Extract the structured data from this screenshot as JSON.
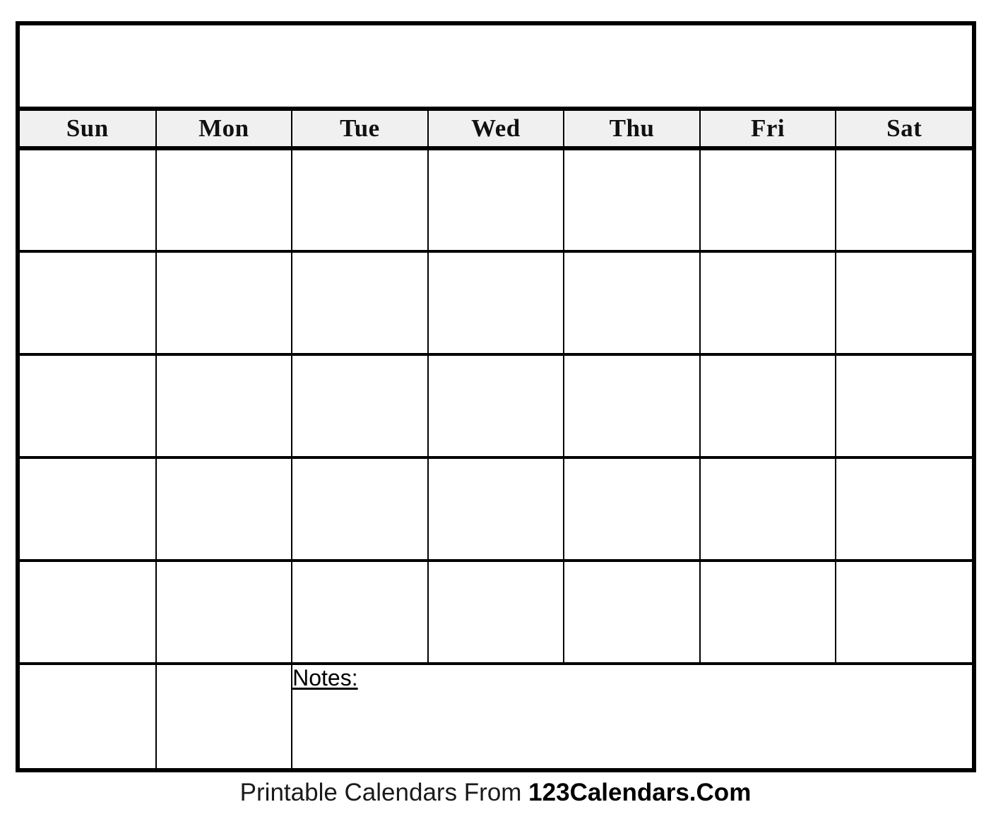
{
  "document": {
    "type": "blank-printable-monthly-calendar",
    "title_row_text": "",
    "background_color": "#ffffff",
    "border_color": "#000000",
    "header_background_color": "#f0f0f0"
  },
  "calendar": {
    "weekday_headers": [
      {
        "label": "Sun"
      },
      {
        "label": "Mon"
      },
      {
        "label": "Tue"
      },
      {
        "label": "Wed"
      },
      {
        "label": "Thu"
      },
      {
        "label": "Fri"
      },
      {
        "label": "Sat"
      }
    ],
    "week_rows": [
      {
        "cells": [
          "",
          "",
          "",
          "",
          "",
          "",
          ""
        ]
      },
      {
        "cells": [
          "",
          "",
          "",
          "",
          "",
          "",
          ""
        ]
      },
      {
        "cells": [
          "",
          "",
          "",
          "",
          "",
          "",
          ""
        ]
      },
      {
        "cells": [
          "",
          "",
          "",
          "",
          "",
          "",
          ""
        ]
      },
      {
        "cells": [
          "",
          "",
          "",
          "",
          "",
          "",
          ""
        ]
      }
    ],
    "last_row": {
      "day_cells": [
        "",
        ""
      ],
      "notes_label": "Notes:",
      "notes_value": "",
      "notes_colspan": 5
    }
  },
  "footer": {
    "prefix": "Printable Calendars From ",
    "brand": "123Calendars.Com"
  }
}
